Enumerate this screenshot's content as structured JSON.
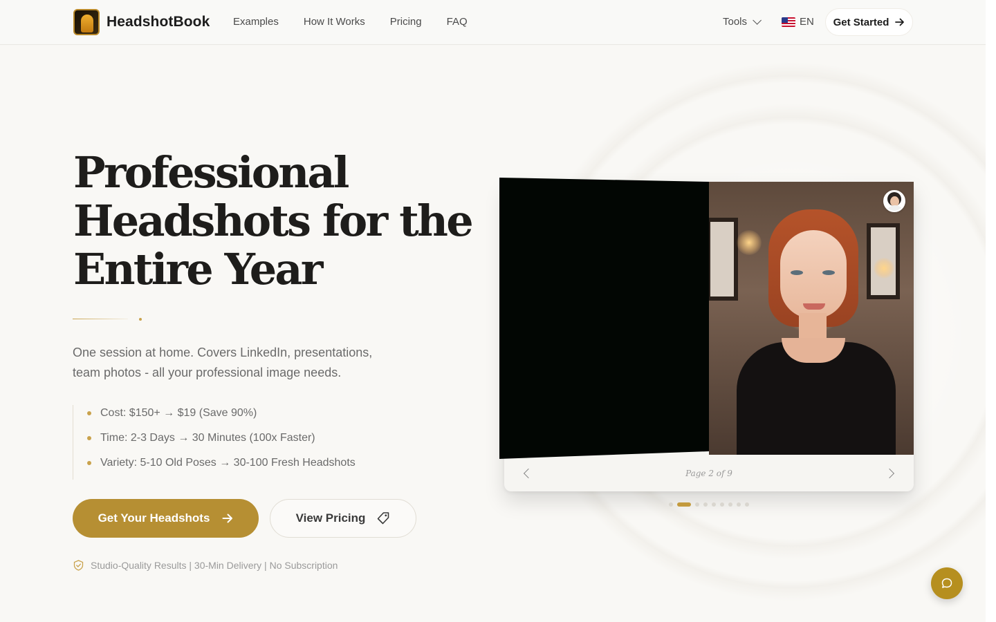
{
  "header": {
    "brand": "HeadshotBook",
    "nav": [
      {
        "label": "Examples"
      },
      {
        "label": "How It Works"
      },
      {
        "label": "Pricing"
      },
      {
        "label": "FAQ"
      }
    ],
    "tools_label": "Tools",
    "lang_label": "EN",
    "cta_label": "Get Started"
  },
  "hero": {
    "title": "Professional Headshots for the Entire Year",
    "subtitle": "One session at home. Covers LinkedIn, presentations, team photos - all your professional image needs.",
    "benefits": [
      "Cost: $150+ → $19 (Save 90%)",
      "Time: 2-3 Days → 30 Minutes (100x Faster)",
      "Variety: 5-10 Old Poses → 30-100 Fresh Headshots"
    ],
    "primary_cta": "Get Your Headshots",
    "secondary_cta": "View Pricing",
    "trust_line": "Studio-Quality Results | 30-Min Delivery | No Subscription"
  },
  "book": {
    "page_label": "Page 2 of 9",
    "current_page": 2,
    "total_pages": 9
  },
  "colors": {
    "accent": "#b68f33",
    "background": "#f9f8f5",
    "text": "#1e1d1b",
    "muted": "#6a6a6a"
  },
  "icons": {
    "logo": "headshotbook-logo-icon",
    "tools": "chevron-down-icon",
    "lang": "us-flag-icon",
    "cta": "arrow-right-icon",
    "pricing": "price-tag-icon",
    "trust": "shield-check-icon",
    "prev": "chevron-left-icon",
    "next": "chevron-right-icon",
    "chat": "chat-bubble-icon"
  }
}
